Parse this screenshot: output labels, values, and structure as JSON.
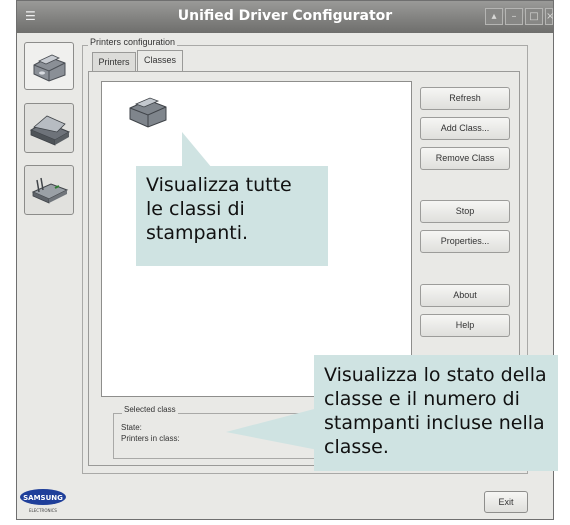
{
  "window": {
    "title": "Unified Driver Configurator"
  },
  "config_group": {
    "label": "Printers configuration",
    "tabs": [
      {
        "label": "Printers",
        "active": false
      },
      {
        "label": "Classes",
        "active": true
      }
    ]
  },
  "sidebar": {
    "items": [
      {
        "icon": "printer-icon",
        "active": true
      },
      {
        "icon": "scanner-icon",
        "active": false
      },
      {
        "icon": "port-icon",
        "active": false
      }
    ]
  },
  "buttons": {
    "refresh": "Refresh",
    "add_class": "Add Class...",
    "remove_class": "Remove Class",
    "stop": "Stop",
    "properties": "Properties...",
    "about": "About",
    "help": "Help",
    "exit": "Exit"
  },
  "selected_class": {
    "legend": "Selected class",
    "state_label": "State:",
    "printers_label": "Printers in class:"
  },
  "logo": {
    "brand": "SAMSUNG",
    "tagline": "ELECTRONICS"
  },
  "callouts": {
    "top": "Visualizza tutte le classi di stampanti.",
    "bottom": "Visualizza lo stato della classe e il numero di stampanti incluse nella classe."
  },
  "colors": {
    "callout_bg": "#cfe3e2",
    "titlebar": "#7e7e7c",
    "window_bg": "#e9e9e6"
  }
}
